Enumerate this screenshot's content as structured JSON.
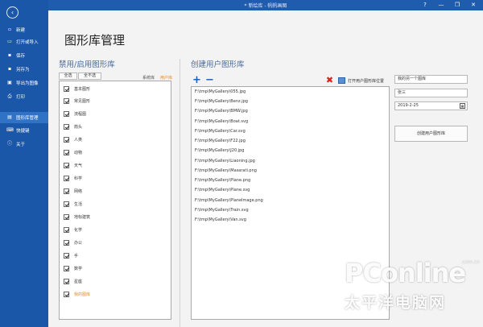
{
  "window": {
    "title": "* 新绘库 - 帆帆画图",
    "controls": [
      "?",
      "—",
      "❐",
      "✕"
    ]
  },
  "sidebar": {
    "back_icon": "arrow-left-icon",
    "items": [
      {
        "label": "新建",
        "icon": "new-file-icon"
      },
      {
        "label": "打开或导入",
        "icon": "open-folder-icon"
      },
      {
        "label": "保存",
        "icon": "save-icon"
      },
      {
        "label": "另存为",
        "icon": "save-as-icon"
      },
      {
        "label": "导出为图像",
        "icon": "export-image-icon"
      },
      {
        "label": "打印",
        "icon": "print-icon"
      },
      {
        "label": "图形库管理",
        "icon": "library-icon",
        "active": true
      },
      {
        "label": "快捷键",
        "icon": "keyboard-icon"
      },
      {
        "label": "关于",
        "icon": "info-icon"
      }
    ]
  },
  "main": {
    "page_title": "图形库管理",
    "left_section": {
      "title": "禁用/启用图形库",
      "select_all": "全选",
      "select_none": "全不选",
      "legend_system": "系统库",
      "legend_user": "用户库",
      "libraries": [
        {
          "label": "基本图形",
          "checked": true
        },
        {
          "label": "常见图形",
          "checked": true
        },
        {
          "label": "流程图",
          "checked": true
        },
        {
          "label": "箭头",
          "checked": true
        },
        {
          "label": "人类",
          "checked": true
        },
        {
          "label": "动物",
          "checked": true
        },
        {
          "label": "天气",
          "checked": true
        },
        {
          "label": "科学",
          "checked": true
        },
        {
          "label": "网络",
          "checked": true
        },
        {
          "label": "生活",
          "checked": true
        },
        {
          "label": "地标建筑",
          "checked": true
        },
        {
          "label": "化学",
          "checked": true
        },
        {
          "label": "办公",
          "checked": true
        },
        {
          "label": "手",
          "checked": true
        },
        {
          "label": "数学",
          "checked": true
        },
        {
          "label": "星座",
          "checked": true
        },
        {
          "label": "我的图库",
          "checked": true,
          "user": true
        }
      ]
    },
    "right_section": {
      "title": "创建用户图形库",
      "open_location_label": "打开用户图形库位置",
      "files": [
        "F:\\tmp\\MyGallery\\055.jpg",
        "F:\\tmp\\MyGallery\\Benz.jpg",
        "F:\\tmp\\MyGallery\\BMW.jpg",
        "F:\\tmp\\MyGallery\\Boat.svg",
        "F:\\tmp\\MyGallery\\Car.svg",
        "F:\\tmp\\MyGallery\\F22.jpg",
        "F:\\tmp\\MyGallery\\J20.jpg",
        "F:\\tmp\\MyGallery\\Liaoning.jpg",
        "F:\\tmp\\MyGallery\\Masarati.png",
        "F:\\tmp\\MyGallery\\Plane.png",
        "F:\\tmp\\MyGallery\\Plane.svg",
        "F:\\tmp\\MyGallery\\PlaneImage.png",
        "F:\\tmp\\MyGallery\\Train.svg",
        "F:\\tmp\\MyGallery\\Van.svg"
      ],
      "library_name_value": "我的另一个图库",
      "author_value": "张三",
      "date_value": "2019-2-25",
      "create_button": "创建用户图形库"
    }
  },
  "watermark": {
    "brand": "PConline",
    "domain": ".com.cn",
    "chinese": "太平洋电脑网"
  },
  "colors": {
    "sidebar": "#1b57a8",
    "accent": "#4a6a9a",
    "user_library": "#e8891b",
    "delete": "#d9221c"
  }
}
